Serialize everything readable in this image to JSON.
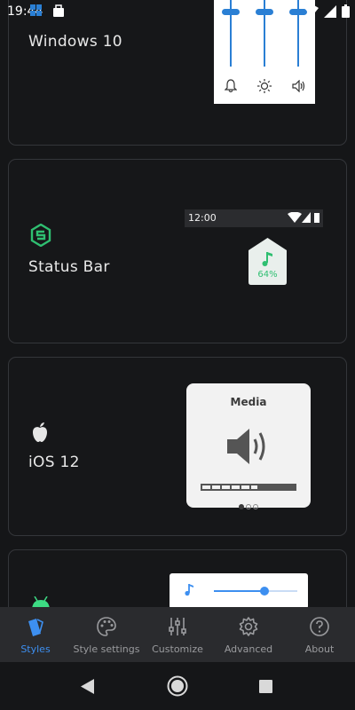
{
  "status_bar": {
    "time": "19:44",
    "icons": [
      "notification-icon",
      "briefcase-icon",
      "wifi-icon",
      "signal-icon",
      "battery-icon"
    ]
  },
  "cards": [
    {
      "title": "Windows 10",
      "preview": {
        "icons": [
          "bell-icon",
          "brightness-icon",
          "volume-icon"
        ]
      }
    },
    {
      "title": "Status Bar",
      "icon": "status-bar-logo-icon",
      "preview": {
        "time": "12:00",
        "percent": "64%",
        "icon": "music-note-icon"
      }
    },
    {
      "title": "iOS 12",
      "icon": "apple-icon",
      "preview": {
        "label": "Media",
        "icon": "speaker-icon",
        "level": 0.6,
        "pages": 3,
        "current_page": 1
      }
    },
    {
      "title": "",
      "icon": "android-icon",
      "preview": {
        "icon": "music-note-icon",
        "level": 0.58
      }
    }
  ],
  "bottom_nav": [
    {
      "label": "Styles",
      "icon": "styles-icon",
      "active": true
    },
    {
      "label": "Style settings",
      "icon": "palette-icon",
      "active": false
    },
    {
      "label": "Customize",
      "icon": "sliders-icon",
      "active": false
    },
    {
      "label": "Advanced",
      "icon": "gear-icon",
      "active": false
    },
    {
      "label": "About",
      "icon": "help-icon",
      "active": false
    }
  ],
  "colors": {
    "background": "#151618",
    "accent": "#3d8ff0",
    "windows_blue": "#2a7fd4",
    "status_green": "#2fbf71"
  }
}
